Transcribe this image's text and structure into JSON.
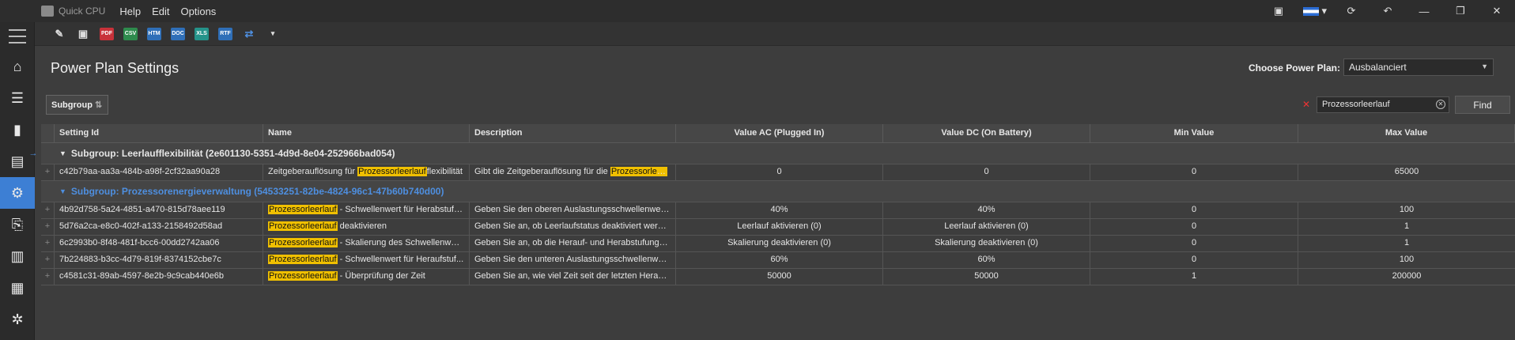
{
  "app": {
    "title": "Quick CPU"
  },
  "menu": [
    "Help",
    "Edit",
    "Options"
  ],
  "window_controls": [
    "image-icon",
    "flag-icon",
    "refresh-icon",
    "undo-icon",
    "minimize",
    "restore",
    "close"
  ],
  "toolbar": {
    "buttons": [
      {
        "name": "edit-icon",
        "label": "AB"
      },
      {
        "name": "save-icon",
        "label": "💾"
      },
      {
        "name": "export-pdf-icon",
        "label": "PDF"
      },
      {
        "name": "export-csv-icon",
        "label": "CSV"
      },
      {
        "name": "export-html-icon",
        "label": "HTML"
      },
      {
        "name": "export-docx-icon",
        "label": "DOCX"
      },
      {
        "name": "export-xls-icon",
        "label": "XLS"
      },
      {
        "name": "export-rtf-icon",
        "label": "RTF"
      }
    ]
  },
  "header": {
    "title": "Power Plan Settings",
    "plan_label": "Choose Power Plan:",
    "plan_value": "Ausbalanciert"
  },
  "groupbar": {
    "chip_label": "Subgroup",
    "search_value": "Prozessorleerlauf",
    "find_label": "Find"
  },
  "grid": {
    "columns": [
      "Setting Id",
      "Name",
      "Description",
      "Value AC (Plugged In)",
      "Value DC (On Battery)",
      "Min Value",
      "Max Value"
    ],
    "groups": [
      {
        "title": "Subgroup: Leerlaufflexibilität (2e601130-5351-4d9d-8e04-252966bad054)",
        "rows": [
          {
            "id": "c42b79aa-aa3a-484b-a98f-2cf32aa90a28",
            "name_pre": "Zeitgeberauflösung für ",
            "name_hl": "Prozessorleerlauf",
            "name_post": "flexibilität",
            "desc_pre": "Gibt die Zeitgeberauflösung für die ",
            "desc_hl": "Prozessorleerl",
            "desc_post": "...",
            "ac": "0",
            "dc": "0",
            "min": "0",
            "max": "65000"
          }
        ]
      },
      {
        "title": "Subgroup: Prozessorenergieverwaltung (54533251-82be-4824-96c1-47b60b740d00)",
        "rows": [
          {
            "id": "4b92d758-5a24-4851-a470-815d78aee119",
            "name_pre": "",
            "name_hl": "Prozessorleerlauf",
            "name_post": " - Schwellenwert für Herabstufung",
            "desc_pre": "Geben Sie den oberen Auslastungsschwellenwert ...",
            "desc_hl": "",
            "desc_post": "",
            "ac": "40%",
            "dc": "40%",
            "min": "0",
            "max": "100"
          },
          {
            "id": "5d76a2ca-e8c0-402f-a133-2158492d58ad",
            "name_pre": "",
            "name_hl": "Prozessorleerlauf",
            "name_post": " deaktivieren",
            "desc_pre": "Geben Sie an, ob Leerlaufstatus deaktiviert werde...",
            "desc_hl": "",
            "desc_post": "",
            "ac": "Leerlauf aktivieren (0)",
            "dc": "Leerlauf aktivieren (0)",
            "min": "0",
            "max": "1"
          },
          {
            "id": "6c2993b0-8f48-481f-bcc6-00dd2742aa06",
            "name_pre": "",
            "name_hl": "Prozessorleerlauf",
            "name_post": " - Skalierung des Schwellenwerts",
            "desc_pre": "Geben Sie an, ob die Herauf- und Herabstufungs...",
            "desc_hl": "",
            "desc_post": "",
            "ac": "Skalierung deaktivieren (0)",
            "dc": "Skalierung deaktivieren (0)",
            "min": "0",
            "max": "1"
          },
          {
            "id": "7b224883-b3cc-4d79-819f-8374152cbe7c",
            "name_pre": "",
            "name_hl": "Prozessorleerlauf",
            "name_post": " - Schwellenwert für Heraufstuf...",
            "desc_pre": "Geben Sie den unteren Auslastungsschwellenwert...",
            "desc_hl": "",
            "desc_post": "",
            "ac": "60%",
            "dc": "60%",
            "min": "0",
            "max": "100"
          },
          {
            "id": "c4581c31-89ab-4597-8e2b-9c9cab440e6b",
            "name_pre": "",
            "name_hl": "Prozessorleerlauf",
            "name_post": " - Überprüfung der Zeit",
            "desc_pre": "Geben Sie an, wie viel Zeit seit der letzten Herauf-...",
            "desc_hl": "",
            "desc_post": "",
            "ac": "50000",
            "dc": "50000",
            "min": "1",
            "max": "200000"
          }
        ]
      }
    ]
  }
}
